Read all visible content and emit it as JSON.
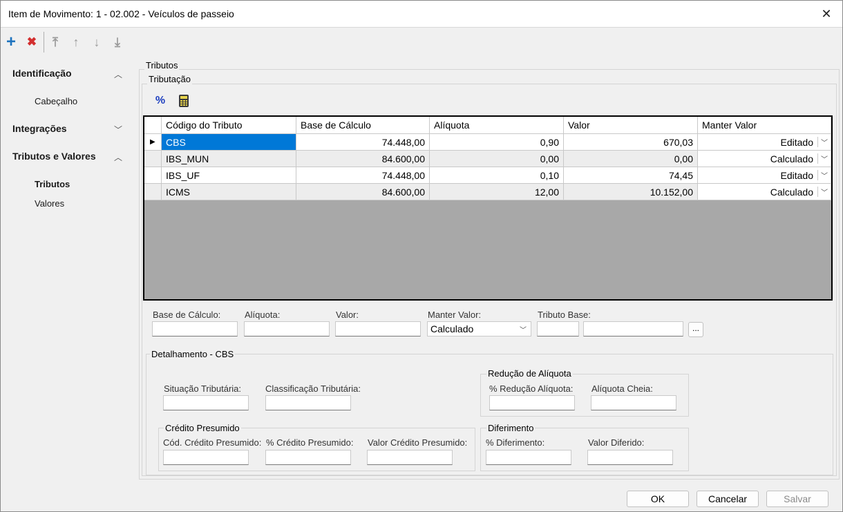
{
  "window": {
    "title": "Item de Movimento: 1 - 02.002 - Veículos de passeio",
    "close_glyph": "✕"
  },
  "toolbar": {
    "add_glyph": "+",
    "delete_glyph": "✖",
    "first_glyph": "⤒",
    "up_glyph": "↑",
    "down_glyph": "↓",
    "last_glyph": "⤓"
  },
  "sidebar": {
    "sections": [
      {
        "label": "Identificação",
        "chevron": "︿",
        "items": [
          "Cabeçalho"
        ]
      },
      {
        "label": "Integrações",
        "chevron": "﹀",
        "items": []
      },
      {
        "label": "Tributos e Valores",
        "chevron": "︿",
        "items": [
          "Tributos",
          "Valores"
        ]
      }
    ]
  },
  "content": {
    "group_title": "Tributos",
    "subgroup_title": "Tributação",
    "icons": {
      "percent": "%",
      "calculator": "calculator-icon"
    }
  },
  "grid": {
    "columns": [
      "Código do Tributo",
      "Base de Cálculo",
      "Alíquota",
      "Valor",
      "Manter Valor"
    ],
    "rows": [
      {
        "codigo": "CBS",
        "base": "74.448,00",
        "aliquota": "0,90",
        "valor": "670,03",
        "manter": "Editado"
      },
      {
        "codigo": "IBS_MUN",
        "base": "84.600,00",
        "aliquota": "0,00",
        "valor": "0,00",
        "manter": "Calculado"
      },
      {
        "codigo": "IBS_UF",
        "base": "74.448,00",
        "aliquota": "0,10",
        "valor": "74,45",
        "manter": "Editado"
      },
      {
        "codigo": "ICMS",
        "base": "84.600,00",
        "aliquota": "12,00",
        "valor": "10.152,00",
        "manter": "Calculado"
      }
    ],
    "current_row_marker": "▶",
    "combo_arrow": "﹀"
  },
  "edit": {
    "base_label": "Base de Cálculo:",
    "aliquota_label": "Alíquota:",
    "valor_label": "Valor:",
    "manter_label": "Manter Valor:",
    "manter_value": "Calculado",
    "tributo_base_label": "Tributo Base:",
    "lookup_glyph": "..."
  },
  "detalhamento": {
    "title": "Detalhamento - CBS",
    "situacao_label": "Situação Tributária:",
    "classificacao_label": "Classificação Tributária:",
    "reducao": {
      "title": "Redução de Alíquota",
      "pct_label": "% Redução Alíquota:",
      "cheia_label": "Alíquota Cheia:"
    },
    "credito": {
      "title": "Crédito Presumido",
      "cod_label": "Cód. Crédito Presumido:",
      "pct_label": "% Crédito Presumido:",
      "valor_label": "Valor Crédito Presumido:"
    },
    "diferimento": {
      "title": "Diferimento",
      "pct_label": "% Diferimento:",
      "valor_label": "Valor Diferido:"
    }
  },
  "buttons": {
    "ok": "OK",
    "cancel": "Cancelar",
    "save": "Salvar"
  },
  "colors": {
    "selection": "#0078d7",
    "add": "#1e73be",
    "delete": "#d32f2f",
    "grid_empty": "#a8a8a8"
  }
}
